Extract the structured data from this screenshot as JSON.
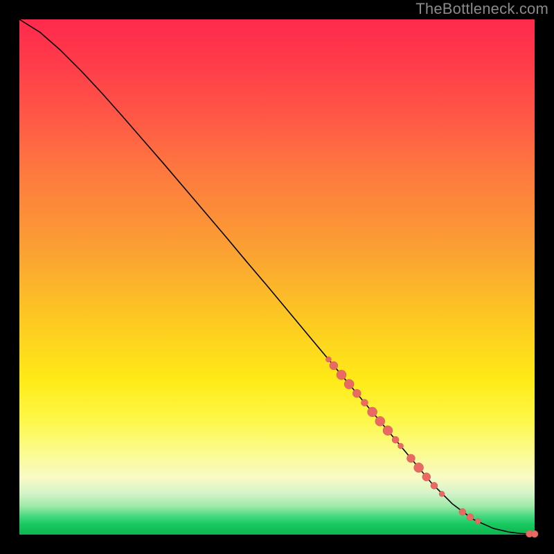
{
  "watermark": "TheBottleneck.com",
  "colors": {
    "curve": "#000000",
    "marker_fill": "#e96a62",
    "marker_stroke": "#cc5a52",
    "page_bg": "#000000"
  },
  "chart_data": {
    "type": "line",
    "title": "",
    "xlabel": "",
    "ylabel": "",
    "xlim": [
      0,
      100
    ],
    "ylim": [
      0,
      100
    ],
    "grid": false,
    "legend": false,
    "series": [
      {
        "name": "curve",
        "x": [
          0,
          4,
          8,
          12,
          16,
          20,
          24,
          28,
          32,
          36,
          40,
          44,
          48,
          52,
          56,
          60,
          64,
          68,
          72,
          76,
          80,
          84,
          88,
          92,
          95,
          97,
          98.5,
          99.5,
          100
        ],
        "y": [
          100,
          97.5,
          94,
          90,
          85.7,
          81.2,
          76.6,
          72,
          67.3,
          62.6,
          57.9,
          53.1,
          48.4,
          43.6,
          38.8,
          34,
          29.2,
          24.4,
          19.6,
          14.8,
          10,
          6,
          3,
          1.2,
          0.5,
          0.25,
          0.15,
          0.1,
          0.1
        ]
      }
    ],
    "markers": [
      {
        "x": 60,
        "y": 34.0,
        "r": 4
      },
      {
        "x": 61,
        "y": 32.8,
        "r": 6
      },
      {
        "x": 62.5,
        "y": 31.0,
        "r": 7
      },
      {
        "x": 64,
        "y": 29.2,
        "r": 7
      },
      {
        "x": 65.5,
        "y": 27.4,
        "r": 6
      },
      {
        "x": 67,
        "y": 25.6,
        "r": 5
      },
      {
        "x": 68.5,
        "y": 23.8,
        "r": 7
      },
      {
        "x": 70,
        "y": 22.0,
        "r": 7
      },
      {
        "x": 71.5,
        "y": 20.2,
        "r": 7
      },
      {
        "x": 73,
        "y": 18.4,
        "r": 5
      },
      {
        "x": 74,
        "y": 17.2,
        "r": 4
      },
      {
        "x": 76,
        "y": 14.8,
        "r": 6
      },
      {
        "x": 77.5,
        "y": 13.0,
        "r": 7
      },
      {
        "x": 79,
        "y": 11.2,
        "r": 6
      },
      {
        "x": 80.5,
        "y": 9.5,
        "r": 5
      },
      {
        "x": 82,
        "y": 7.9,
        "r": 4
      },
      {
        "x": 86,
        "y": 4.4,
        "r": 5
      },
      {
        "x": 87.5,
        "y": 3.4,
        "r": 5
      },
      {
        "x": 89,
        "y": 2.6,
        "r": 4
      },
      {
        "x": 99,
        "y": 0.15,
        "r": 5
      },
      {
        "x": 100,
        "y": 0.12,
        "r": 5
      }
    ]
  }
}
